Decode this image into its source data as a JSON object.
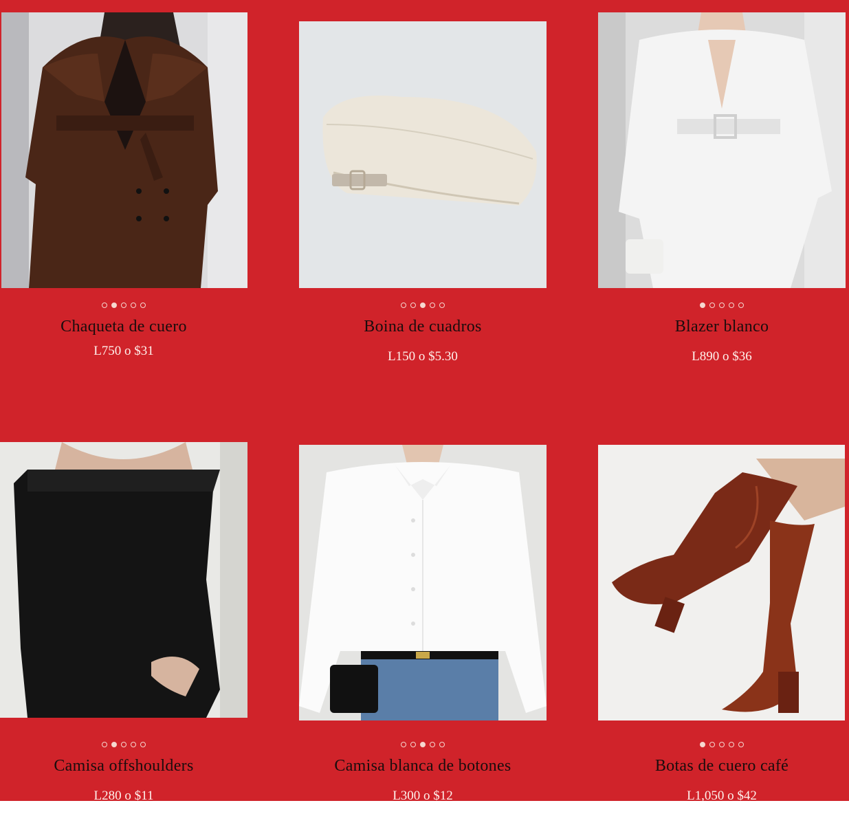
{
  "products": [
    {
      "title": "Chaqueta de cuero",
      "price": "L750 o $31",
      "image": "brown-leather-trench-coat",
      "dots": 5,
      "active_dot": 1
    },
    {
      "title": "Boina de cuadros",
      "price": "L150 o $5.30",
      "image": "cream-beret",
      "dots": 5,
      "active_dot": 2
    },
    {
      "title": "Blazer blanco",
      "price": "L890 o $36",
      "image": "white-blazer-dress",
      "dots": 5,
      "active_dot": 0
    },
    {
      "title": "Camisa offshoulders",
      "price": "L280 o $11",
      "image": "black-off-shoulder-top",
      "dots": 5,
      "active_dot": 1
    },
    {
      "title": "Camisa blanca de botones",
      "price": "L300 o $12",
      "image": "white-button-shirt",
      "dots": 5,
      "active_dot": 2
    },
    {
      "title": "Botas de cuero café",
      "price": "L1,050 o $42",
      "image": "brown-croc-knee-boots",
      "dots": 5,
      "active_dot": 0
    }
  ],
  "colors": {
    "background": "#d0232a",
    "title": "#1a0d0d",
    "price": "#fff1ec",
    "dot": "#f6d7cf"
  }
}
